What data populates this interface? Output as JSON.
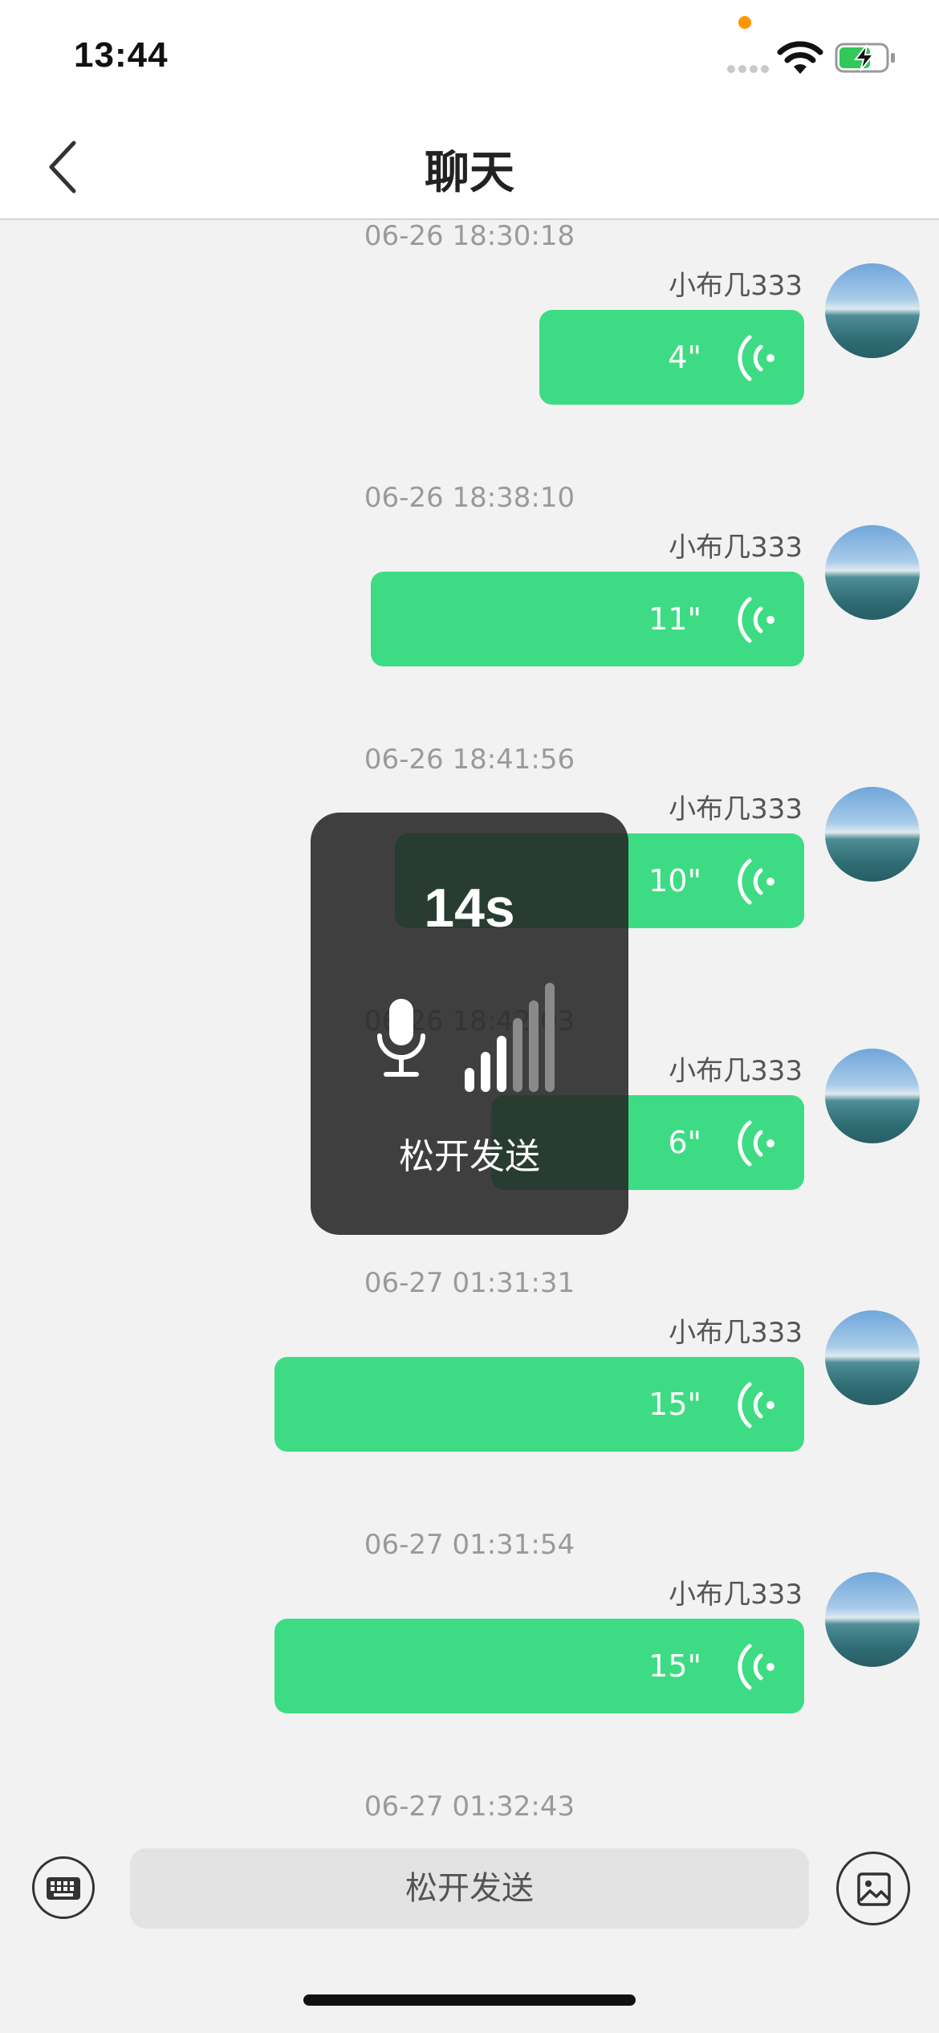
{
  "status_bar": {
    "time": "13:44",
    "wifi_icon": "wifi-icon",
    "battery_icon": "battery-charging-icon",
    "accent_dot_color": "#ff9500"
  },
  "nav": {
    "back_icon": "chevron-left-icon",
    "title": "聊天"
  },
  "messages": [
    {
      "timestamp": "06-26 18:30:18",
      "sender": "小布几333",
      "duration": "4\""
    },
    {
      "timestamp": "06-26 18:38:10",
      "sender": "小布几333",
      "duration": "11\""
    },
    {
      "timestamp": "06-26 18:41:56",
      "sender": "小布几333",
      "duration": "10\""
    },
    {
      "timestamp": "06-26 18:42:03",
      "sender": "小布几333",
      "duration": "6\""
    },
    {
      "timestamp": "06-27 01:31:31",
      "sender": "小布几333",
      "duration": "15\""
    },
    {
      "timestamp": "06-27 01:31:54",
      "sender": "小布几333",
      "duration": "15\""
    }
  ],
  "last_timestamp": "06-27 01:32:43",
  "recording": {
    "elapsed": "14s",
    "hint": "松开发送",
    "mic_icon": "microphone-icon",
    "level_icon": "volume-level-icon"
  },
  "bottom_bar": {
    "keyboard_icon": "keyboard-icon",
    "hold_button_label": "松开发送",
    "image_icon": "image-icon"
  },
  "colors": {
    "bubble": "#3ddc84",
    "background": "#f2f2f2",
    "overlay": "#262626"
  }
}
